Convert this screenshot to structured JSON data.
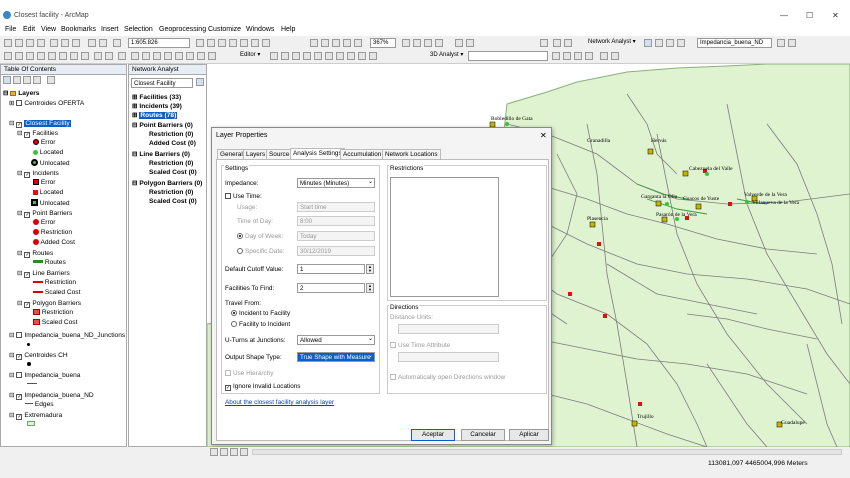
{
  "window": {
    "title": "Closest facility - ArcMap",
    "controls": [
      "—",
      "☐",
      "✕"
    ]
  },
  "menu": [
    "File",
    "Edit",
    "View",
    "Bookmarks",
    "Insert",
    "Selection",
    "Geoprocessing",
    "Customize",
    "Windows",
    "Help"
  ],
  "toolbar": {
    "scale": "1:605.826",
    "zoom": "367%",
    "editor": "Editor ▾",
    "network_analyst": "Network Analyst ▾",
    "network_dataset": "Impedancia_buena_ND",
    "analyst_3d": "3D Analyst ▾"
  },
  "toc": {
    "title": "Table Of Contents",
    "items": [
      "Layers",
      "Centroides OFERTA",
      "Closest Facility",
      "Facilities",
      "Error",
      "Located",
      "Unlocated",
      "Incidents",
      "Error",
      "Located",
      "Unlocated",
      "Point Barriers",
      "Error",
      "Restriction",
      "Added Cost",
      "Routes",
      "Routes",
      "Line Barriers",
      "Restriction",
      "Scaled Cost",
      "Polygon Barriers",
      "Restriction",
      "Scaled Cost",
      "Impedancia_buena_ND_Junctions",
      "Centroides CH",
      "Impedancia_buena",
      "Impedancia_buena_ND",
      "Edges",
      "Extremadura"
    ]
  },
  "network_analyst": {
    "title": "Network Analyst",
    "layer": "Closest Facility",
    "items": [
      "Facilities (33)",
      "Incidents (39)",
      "Routes (78)",
      "Point Barriers (0)",
      "Restriction (0)",
      "Added Cost (0)",
      "Line Barriers (0)",
      "Restriction (0)",
      "Scaled Cost (0)",
      "Polygon Barriers (0)",
      "Restriction (0)",
      "Scaled Cost (0)"
    ]
  },
  "dialog": {
    "title": "Layer Properties",
    "close": "✕",
    "tabs": [
      "General",
      "Layers",
      "Source",
      "Analysis Settings",
      "Accumulation",
      "Network Locations"
    ],
    "settings": {
      "group": "Settings",
      "impedance_label": "Impedance:",
      "impedance": "Minutes (Minutes)",
      "use_time": "Use Time:",
      "usage_label": "Usage:",
      "usage": "Start time",
      "time_of_day_label": "Time of Day:",
      "time_of_day": "8:00",
      "day_of_week": "Day of Week:",
      "day_of_week_value": "Today",
      "specific_date": "Specific Date:",
      "specific_date_value": "30/12/2019",
      "cutoff_label": "Default Cutoff Value:",
      "cutoff": "1",
      "facilities_label": "Facilities To Find:",
      "facilities": "2",
      "travel_from": "Travel From:",
      "incident_to_facility": "Incident to Facility",
      "facility_to_incident": "Facility to Incident",
      "uturns_label": "U-Turns at Junctions:",
      "uturns": "Allowed",
      "shape_label": "Output Shape Type:",
      "shape": "True Shape with Measure",
      "use_hierarchy": "Use Hierarchy",
      "ignore_invalid": "Ignore Invalid Locations",
      "about_link": "About the closest facility analysis layer"
    },
    "restrictions": "Restrictions",
    "directions": {
      "group": "Directions",
      "distance_units": "Distance Units:",
      "use_time_attribute": "Use Time Attribute",
      "auto_open": "Automatically open Directions window"
    },
    "buttons": {
      "ok": "Aceptar",
      "cancel": "Cancelar",
      "apply": "Aplicar"
    }
  },
  "map": {
    "towns": [
      "Robledillo de Gata",
      "Granadilla",
      "Hervás",
      "Cabezuela del Valle",
      "Garganta la Olla",
      "Cuacos de Yuste",
      "Valverde de la Vera",
      "Villanueva de la Vera",
      "Pasarón de la Vera",
      "Plasencia",
      "Trujillo",
      "Guadalupe"
    ]
  },
  "status": {
    "coords": "113081,097  4465004,996 Meters"
  }
}
